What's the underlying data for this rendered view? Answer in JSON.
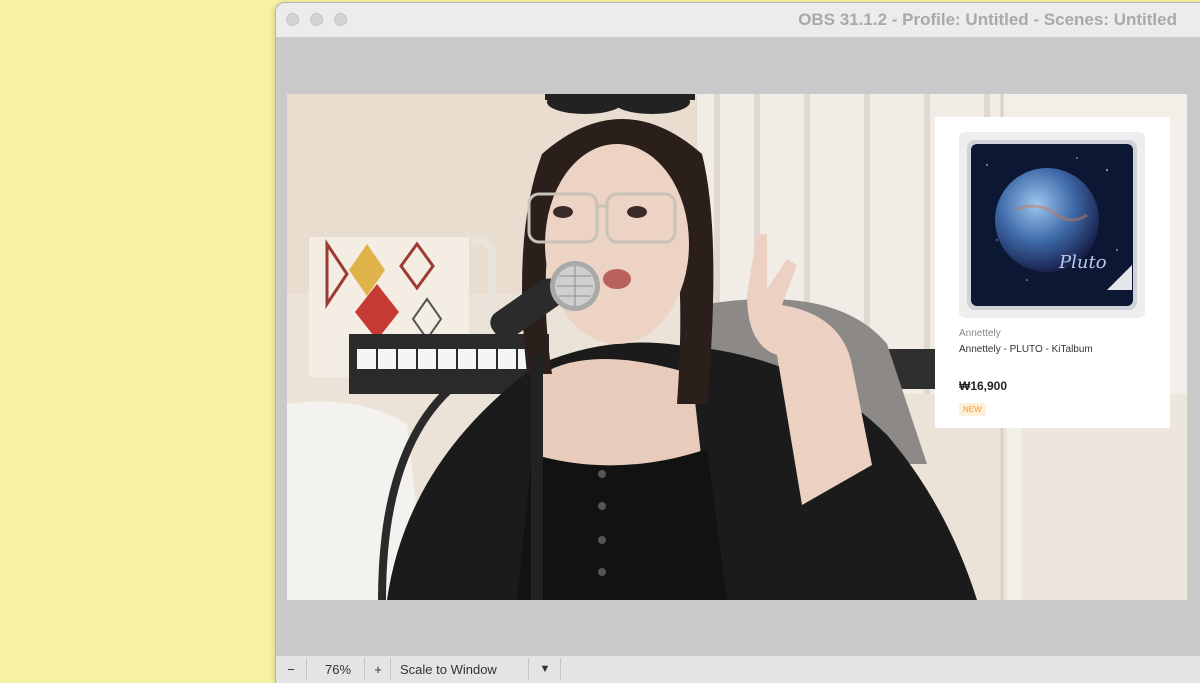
{
  "window": {
    "title": "OBS 31.1.2 - Profile: Untitled - Scenes: Untitled"
  },
  "product_card": {
    "artist": "Annettely",
    "title": "Annettely - PLUTO - KiTalbum",
    "price": "₩16,900",
    "badge": "NEW",
    "album_text": "Pluto"
  },
  "bottom_bar": {
    "zoom_out": "−",
    "zoom_level": "76%",
    "zoom_in": "+",
    "scale_mode": "Scale to Window",
    "dropdown_icon": "▼"
  },
  "colors": {
    "desktop": "#f8f3a4",
    "window_bg": "#c8c8c8",
    "badge_text": "#f29a3a"
  }
}
